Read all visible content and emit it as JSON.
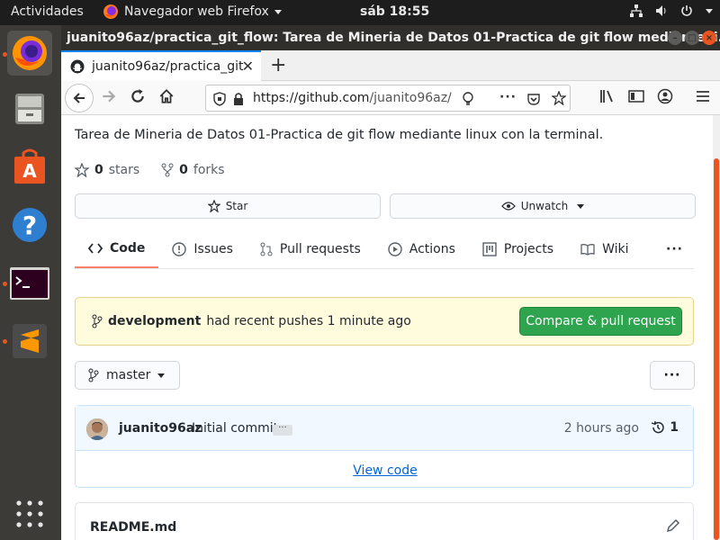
{
  "topbar": {
    "activities": "Actividades",
    "app_name": "Navegador web Firefox",
    "clock": "sáb 18:55"
  },
  "dock": {
    "items": [
      "firefox",
      "files",
      "software",
      "help",
      "terminal",
      "sublime-text",
      "show-apps"
    ]
  },
  "window": {
    "title": "juanito96az/practica_git_flow: Tarea de Mineria de Datos 01-Practica de git flow mediante li..."
  },
  "tab": {
    "title": "juanito96az/practica_git"
  },
  "urlbar": {
    "scheme": "https://",
    "host": "github.com",
    "path": "/juanito96az/"
  },
  "repo": {
    "description": "Tarea de Mineria de Datos 01-Practica de git flow mediante linux con la terminal.",
    "stars_count": "0",
    "stars_label": "stars",
    "forks_count": "0",
    "forks_label": "forks",
    "star_button": "Star",
    "watch_button": "Unwatch"
  },
  "repo_nav": {
    "tabs": [
      "Code",
      "Issues",
      "Pull requests",
      "Actions",
      "Projects",
      "Wiki"
    ],
    "more": "···"
  },
  "flash": {
    "branch": "development",
    "message": "had recent pushes 1 minute ago",
    "button": "Compare & pull request"
  },
  "branch_select": {
    "label": "master"
  },
  "commit": {
    "author": "juanito96az",
    "message": "Initial commit",
    "ellipsis": "···",
    "time": "2 hours ago",
    "count": "1",
    "view_code": "View code"
  },
  "readme": {
    "title": "README.md"
  },
  "colors": {
    "accent_orange": "#e95420",
    "github_green": "#2ea44f",
    "link_blue": "#0366d6"
  }
}
